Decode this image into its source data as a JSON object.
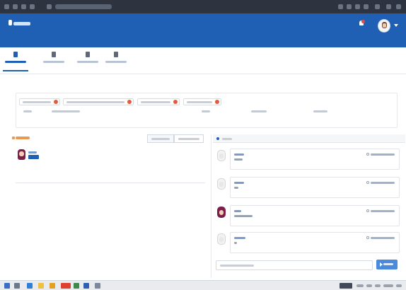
{
  "browser": {
    "address": ""
  },
  "header": {
    "app_name": "",
    "brand_color": "#1f5fb4",
    "notification_count": ""
  },
  "nav": {
    "items": [
      {
        "label": "",
        "icon": "home-icon",
        "active": true
      },
      {
        "label": "",
        "icon": "calendar-icon",
        "active": false
      },
      {
        "label": "",
        "icon": "calendar-icon",
        "active": false
      },
      {
        "label": "",
        "icon": "document-icon",
        "active": false
      }
    ]
  },
  "filters": {
    "chips": [
      {
        "label": ""
      },
      {
        "label": ""
      },
      {
        "label": ""
      },
      {
        "label": ""
      }
    ],
    "columns": [
      "",
      "",
      "",
      "",
      ""
    ]
  },
  "recent": {
    "title": "",
    "buttons": [
      "",
      ""
    ],
    "items": [
      {
        "name": "",
        "tag": ""
      }
    ]
  },
  "chat": {
    "title": "",
    "messages": [
      {
        "author": "",
        "text": "",
        "time": ""
      },
      {
        "author": "",
        "text": "",
        "time": ""
      },
      {
        "author": "",
        "text": "",
        "time": ""
      },
      {
        "author": "",
        "text": "",
        "time": ""
      }
    ],
    "input_placeholder": "",
    "send_label": ""
  },
  "colors": {
    "accent": "#1f5fb4",
    "chip_close": "#e55a3c",
    "recent_title": "#e89a55",
    "send_button": "#4a89dc"
  },
  "taskbar": {
    "language": "",
    "clock": ""
  }
}
